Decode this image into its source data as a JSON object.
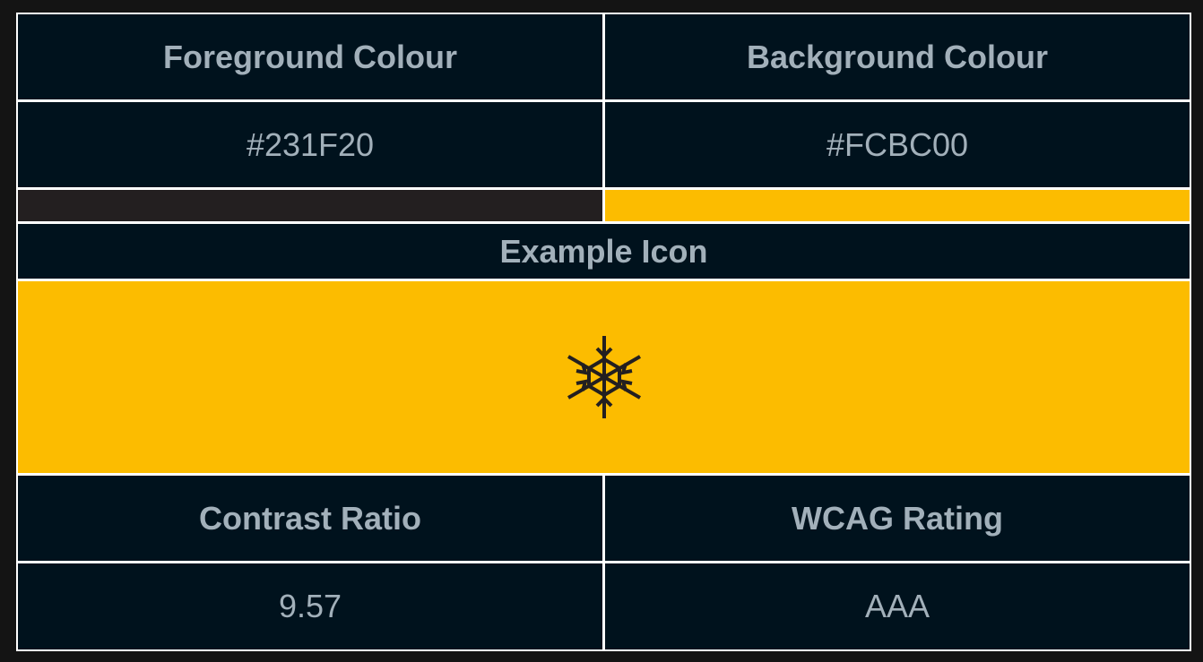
{
  "colors": {
    "foreground": "#231F20",
    "background": "#FCBC00",
    "cell_bg": "#00121D",
    "text": "#A2B0BA",
    "border": "#FFFFFF"
  },
  "table": {
    "fg_header": "Foreground Colour",
    "bg_header": "Background Colour",
    "fg_value": "#231F20",
    "bg_value": "#FCBC00",
    "example_header": "Example Icon",
    "example_icon": "snowflake-icon",
    "contrast_header": "Contrast Ratio",
    "rating_header": "WCAG Rating",
    "contrast_value": "9.57",
    "rating_value": "AAA"
  }
}
